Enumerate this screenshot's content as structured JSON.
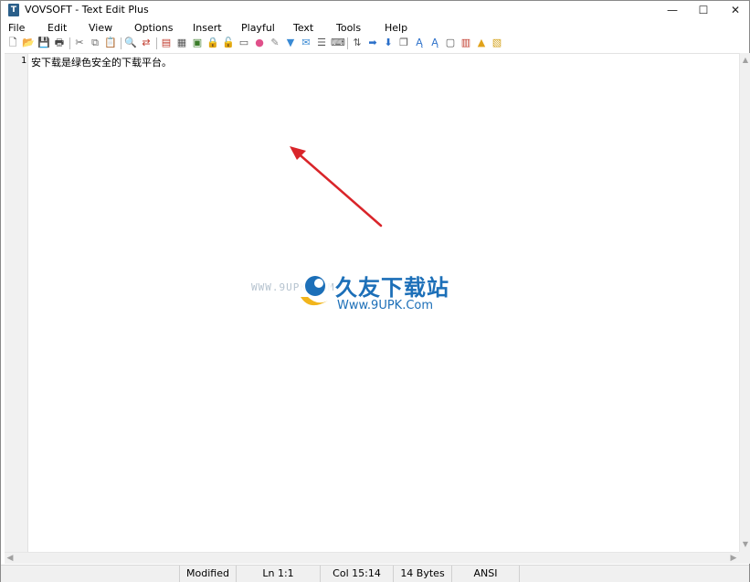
{
  "window": {
    "title": "VOVSOFT - Text Edit Plus",
    "app_icon_glyph": "T",
    "controls": {
      "minimize": "—",
      "maximize": "☐",
      "close": "✕"
    }
  },
  "menu": {
    "items": [
      "File",
      "Edit",
      "View",
      "Options",
      "Insert",
      "Playful",
      "Text",
      "Tools",
      "Help"
    ]
  },
  "toolbar": {
    "buttons": [
      {
        "name": "new-file",
        "glyph": "🗋",
        "color": "#333333"
      },
      {
        "name": "open-file",
        "glyph": "📂",
        "color": "#c7921c"
      },
      {
        "name": "save",
        "glyph": "💾",
        "color": "#2b2b2b"
      },
      {
        "name": "print",
        "glyph": "🖶",
        "color": "#444444"
      },
      {
        "name": "cut",
        "glyph": "✂",
        "color": "#666666"
      },
      {
        "name": "copy",
        "glyph": "⧉",
        "color": "#666666"
      },
      {
        "name": "paste",
        "glyph": "📋",
        "color": "#666666"
      },
      {
        "name": "find",
        "glyph": "🔍",
        "color": "#2b2b2b"
      },
      {
        "name": "replace",
        "glyph": "⇄",
        "color": "#c0392b"
      },
      {
        "name": "bookmark",
        "glyph": "▤",
        "color": "#c0392b"
      },
      {
        "name": "view-doc",
        "glyph": "▦",
        "color": "#555555"
      },
      {
        "name": "image",
        "glyph": "▣",
        "color": "#3b7d2a"
      },
      {
        "name": "lock",
        "glyph": "🔒",
        "color": "#d49a1a"
      },
      {
        "name": "unlock",
        "glyph": "🔓",
        "color": "#d49a1a"
      },
      {
        "name": "document",
        "glyph": "▭",
        "color": "#555555"
      },
      {
        "name": "color-wheel",
        "glyph": "●",
        "color": "#e0508a"
      },
      {
        "name": "pen",
        "glyph": "✎",
        "color": "#888888"
      },
      {
        "name": "filter",
        "glyph": "▼",
        "color": "#3a8ad4"
      },
      {
        "name": "mail",
        "glyph": "✉",
        "color": "#3a8ad4"
      },
      {
        "name": "list",
        "glyph": "☰",
        "color": "#555555"
      },
      {
        "name": "keyboard",
        "glyph": "⌨",
        "color": "#555555"
      },
      {
        "name": "sort",
        "glyph": "⇅",
        "color": "#555555"
      },
      {
        "name": "arrow-right",
        "glyph": "➡",
        "color": "#2a6fc9"
      },
      {
        "name": "arrow-down",
        "glyph": "⬇",
        "color": "#2a6fc9"
      },
      {
        "name": "duplicate",
        "glyph": "❐",
        "color": "#555555"
      },
      {
        "name": "text-a",
        "glyph": "Ą",
        "color": "#2a6fc9"
      },
      {
        "name": "text-b",
        "glyph": "Ą",
        "color": "#2a6fc9"
      },
      {
        "name": "window",
        "glyph": "▢",
        "color": "#555555"
      },
      {
        "name": "calendar",
        "glyph": "▥",
        "color": "#c0392b"
      },
      {
        "name": "warning",
        "glyph": "▲",
        "color": "#e0a21a"
      },
      {
        "name": "image-frame",
        "glyph": "▧",
        "color": "#d4a21a"
      }
    ]
  },
  "editor": {
    "lines": [
      {
        "number": "1",
        "text": "安下载是绿色安全的下载平台。"
      }
    ]
  },
  "scrollbars": {
    "up": "▲",
    "down": "▼",
    "left": "◀",
    "right": "▶"
  },
  "statusbar": {
    "state": "Modified",
    "line": "Ln 1:1",
    "column": "Col 15:14",
    "size": "14 Bytes",
    "encoding": "ANSI"
  },
  "watermark": {
    "url_left": "WWW.9UPK.COM",
    "brand": "久友下载站",
    "url": "Www.9UPK.Com"
  },
  "colors": {
    "annotation_arrow": "#d9252a",
    "watermark_blue": "#1c6fb8",
    "watermark_yellow": "#f2b51c"
  }
}
